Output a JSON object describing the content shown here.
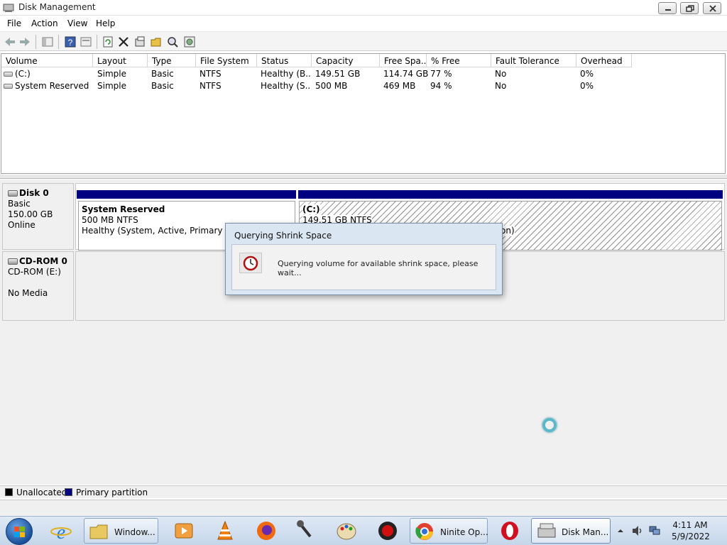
{
  "window": {
    "title": "Disk Management"
  },
  "menu": [
    "File",
    "Action",
    "View",
    "Help"
  ],
  "toolbar_icons": [
    "back-icon",
    "forward-icon",
    "show-pane-icon",
    "help-icon",
    "properties-icon",
    "refresh-icon",
    "delete-icon",
    "properties-sheet-icon",
    "open-icon",
    "search-icon",
    "settings-icon"
  ],
  "volume_table": {
    "columns": [
      "Volume",
      "Layout",
      "Type",
      "File System",
      "Status",
      "Capacity",
      "Free Spa...",
      "% Free",
      "Fault Tolerance",
      "Overhead"
    ],
    "rows": [
      [
        "(C:)",
        "Simple",
        "Basic",
        "NTFS",
        "Healthy (B...",
        "149.51 GB",
        "114.74 GB",
        "77 %",
        "No",
        "0%"
      ],
      [
        "System Reserved",
        "Simple",
        "Basic",
        "NTFS",
        "Healthy (S...",
        "500 MB",
        "469 MB",
        "94 %",
        "No",
        "0%"
      ]
    ]
  },
  "disk0": {
    "name": "Disk 0",
    "type": "Basic",
    "size": "150.00 GB",
    "state": "Online",
    "partitions": [
      {
        "name": "System Reserved",
        "size_fs": "500 MB NTFS",
        "status": "Healthy (System, Active, Primary Partiti"
      },
      {
        "name": "(C:)",
        "size_fs": "149.51 GB NTFS",
        "status_tail": "on)"
      }
    ]
  },
  "cdrom0": {
    "name": "CD-ROM 0",
    "drive": "CD-ROM (E:)",
    "media": "No Media"
  },
  "legend": [
    {
      "label": "Unallocated",
      "color": "#000000"
    },
    {
      "label": "Primary partition",
      "color": "#000080"
    }
  ],
  "dialog": {
    "title": "Querying Shrink Space",
    "message": "Querying volume for available shrink space, please wait..."
  },
  "taskbar": {
    "tasks": [
      {
        "label": "Window..."
      },
      {
        "label": "Ninite Op..."
      },
      {
        "label": "Disk Man..."
      }
    ],
    "time": "4:11 AM",
    "date": "5/9/2022"
  }
}
